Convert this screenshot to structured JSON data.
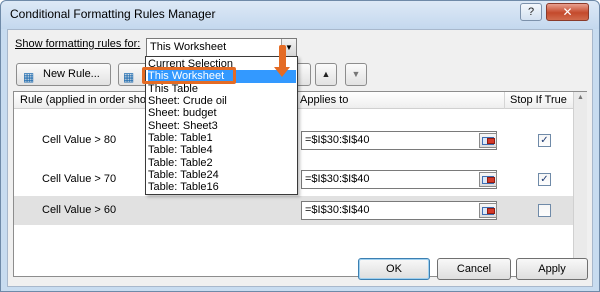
{
  "window": {
    "title": "Conditional Formatting Rules Manager",
    "help_label": "?",
    "close_label": "✕"
  },
  "scope": {
    "label": "Show formatting rules for:",
    "selected": "This Worksheet",
    "options": [
      "Current Selection",
      "This Worksheet",
      "This Table",
      "Sheet: Crude oil",
      "Sheet: budget",
      "Sheet: Sheet3",
      "Table: Table1",
      "Table: Table4",
      "Table: Table2",
      "Table: Table24",
      "Table: Table16"
    ],
    "highlighted_index": 1
  },
  "toolbar": {
    "new_rule": "New Rule..."
  },
  "table": {
    "headers": {
      "rule": "Rule (applied in order show",
      "applies": "Applies to",
      "stop": "Stop If True"
    },
    "rows": [
      {
        "rule": "Cell Value > 80",
        "applies": "=$I$30:$I$40",
        "stop": true,
        "selected": false
      },
      {
        "rule": "Cell Value > 70",
        "applies": "=$I$30:$I$40",
        "stop": true,
        "selected": false
      },
      {
        "rule": "Cell Value > 60",
        "applies": "=$I$30:$I$40",
        "stop": false,
        "selected": true
      }
    ]
  },
  "buttons": {
    "ok": "OK",
    "cancel": "Cancel",
    "apply": "Apply"
  },
  "colors": {
    "accent_orange": "#e46b24",
    "selection_blue": "#3399ff"
  }
}
